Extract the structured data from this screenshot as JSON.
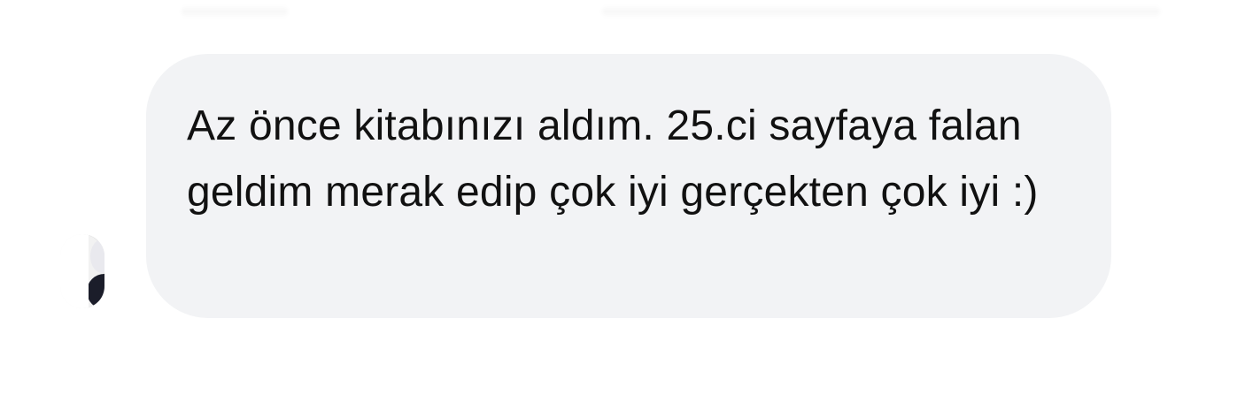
{
  "message": {
    "text": "Az önce kitabınızı aldım. 25.ci sayfaya falan geldim merak edip çok iyi gerçekten çok iyi :)"
  },
  "colors": {
    "background": "#ffffff",
    "bubble": "#f2f3f5",
    "text": "#111111"
  }
}
